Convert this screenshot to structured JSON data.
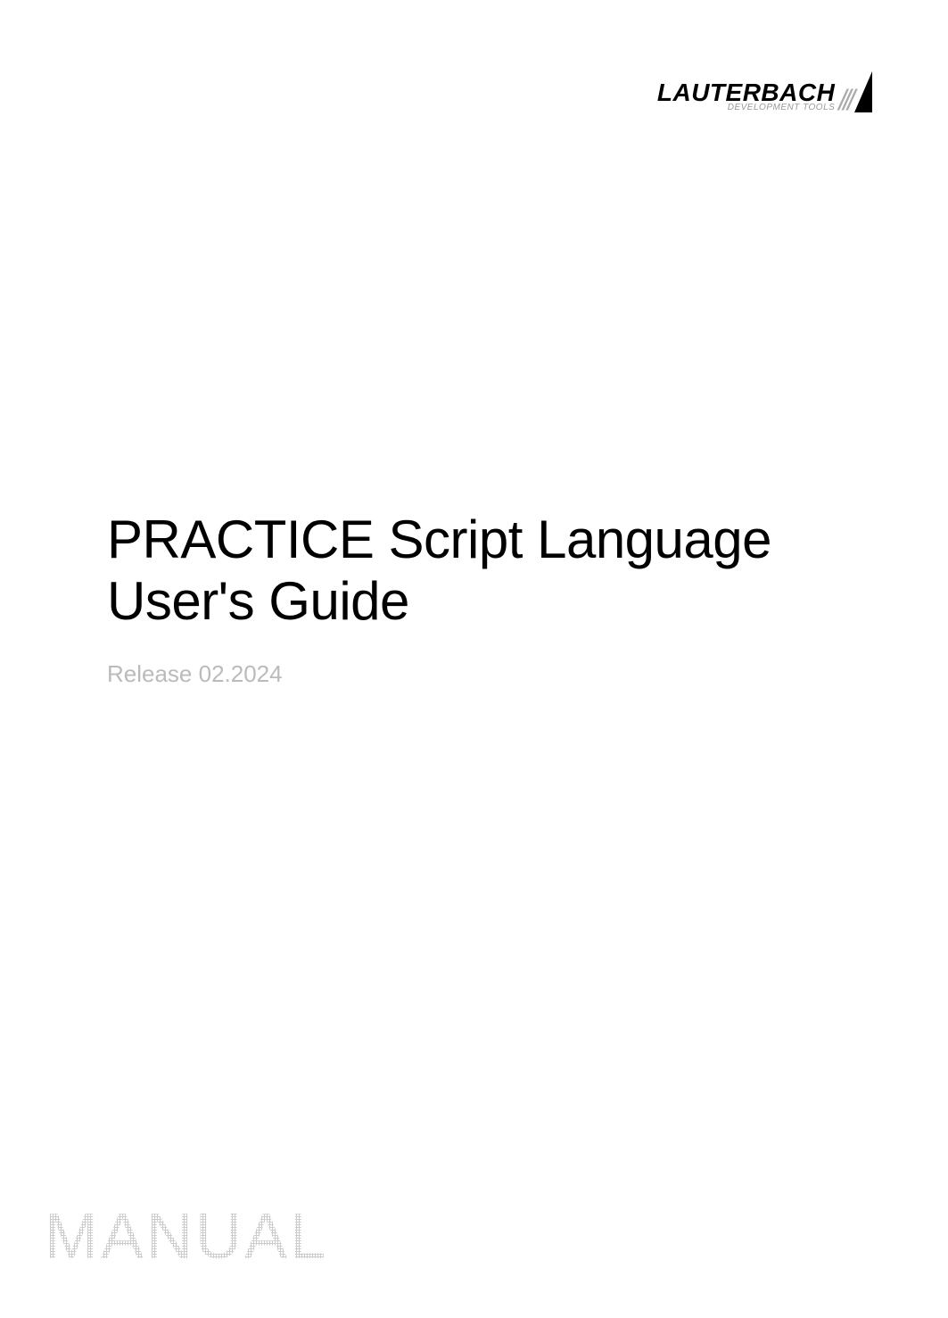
{
  "logo": {
    "brand": "LAUTERBACH",
    "tagline": "DEVELOPMENT TOOLS"
  },
  "title": "PRACTICE Script Language User's Guide",
  "release": "Release 02.2024",
  "watermark": "MANUAL"
}
